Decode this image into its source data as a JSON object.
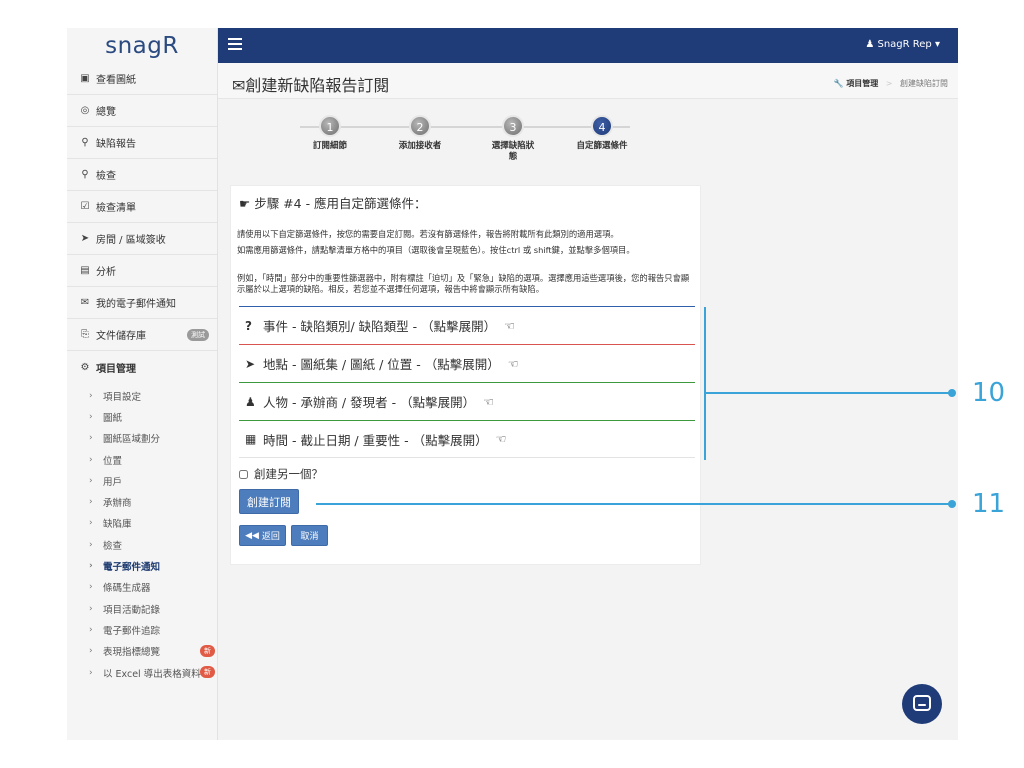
{
  "app": {
    "logo_text": "snagR",
    "user_name": "SnagR Rep",
    "user_icon": "user-icon"
  },
  "sidebar": {
    "items": [
      {
        "icon": "image-icon",
        "glyph": "▣",
        "label": "查看圖紙"
      },
      {
        "icon": "dashboard-icon",
        "glyph": "◎",
        "label": "總覽"
      },
      {
        "icon": "map-marker-icon",
        "glyph": "⚲",
        "label": "缺陷報告"
      },
      {
        "icon": "search-icon",
        "glyph": "⚲",
        "label": "檢查"
      },
      {
        "icon": "checklist-icon",
        "glyph": "☑",
        "label": "檢查清單"
      },
      {
        "icon": "location-arrow-icon",
        "glyph": "➤",
        "label": "房間 / 區域簽收"
      },
      {
        "icon": "bar-chart-icon",
        "glyph": "▤",
        "label": "分析"
      },
      {
        "icon": "envelope-icon",
        "glyph": "✉",
        "label": "我的電子郵件通知"
      },
      {
        "icon": "document-store-icon",
        "glyph": "⎘",
        "label": "文件儲存庫",
        "badge": "測試"
      },
      {
        "icon": "cogs-icon",
        "glyph": "⚙",
        "label": "項目管理"
      }
    ],
    "sub_items": [
      {
        "label": "項目設定"
      },
      {
        "label": "圖紙"
      },
      {
        "label": "圖紙區域劃分"
      },
      {
        "label": "位置"
      },
      {
        "label": "用戶"
      },
      {
        "label": "承辦商"
      },
      {
        "label": "缺陷庫"
      },
      {
        "label": "檢查"
      },
      {
        "label": "電子郵件通知",
        "active": true
      },
      {
        "label": "條碼生成器"
      },
      {
        "label": "項目活動記錄"
      },
      {
        "label": "電子郵件追踪"
      },
      {
        "label": "表現指標總覽",
        "badge": "新"
      },
      {
        "label": "以 Excel 導出表格資料",
        "badge": "新"
      }
    ]
  },
  "header": {
    "title": "創建新缺陷報告訂閱",
    "title_icon": "envelope-icon",
    "breadcrumb": [
      "項目管理",
      "創建缺陷訂閱"
    ],
    "breadcrumb_icon": "wrench-icon"
  },
  "wizard": {
    "current": 4,
    "steps": [
      {
        "number": "1",
        "label": "訂閱細節"
      },
      {
        "number": "2",
        "label": "添加接收者"
      },
      {
        "number": "3",
        "label": "選擇缺陷狀態"
      },
      {
        "number": "4",
        "label": "自定篩選條件"
      }
    ]
  },
  "content": {
    "step_title": "步驟 #4 - 應用自定篩選條件：",
    "step_icon": "hand-pointer-icon",
    "paragraph1": "請使用以下自定篩選條件，按您的需要自定訂閱。若沒有篩選條件，報告將附載所有此類別的適用選項。",
    "paragraph2": "如需應用篩選條件，請點擊清單方格中的項目（選取後會呈現藍色）。按住ctrl 或 shift鍵，並點擊多個項目。",
    "paragraph3": "例如，「時間」部分中的重要性篩選器中，附有標註「迫切」及「緊急」缺陷的選項。選擇應用這些選項後，您的報告只會顯示屬於以上選項的缺陷。相反，若您並不選擇任何選項，報告中將會顯示所有缺陷。",
    "filters": [
      {
        "icon": "question-icon",
        "glyph": "?",
        "label": "事件 - 缺陷類別/ 缺陷類型 - （點擊展開）"
      },
      {
        "icon": "location-arrow-icon",
        "glyph": "➤",
        "label": "地點 - 圖紙集 / 圖紙 / 位置 - （點擊展開）"
      },
      {
        "icon": "users-icon",
        "glyph": "👥",
        "label": "人物 - 承辦商 / 發現者 - （點擊展開）"
      },
      {
        "icon": "calendar-icon",
        "glyph": "▦",
        "label": "時間 - 截止日期 / 重要性 - （點擊展開）"
      }
    ],
    "expand_icon": "hand-point-left-icon",
    "create_another_label": "創建另一個？",
    "create_button": "創建訂閱",
    "back_button": "返回",
    "cancel_button": "取消"
  },
  "annotations": {
    "label_10": "10",
    "label_11": "11",
    "color": "#3aa3d8"
  },
  "colors": {
    "navy": "#1f3b78",
    "button_blue": "#4d7dbd",
    "filter_blue": "#2f5fa9",
    "filter_red": "#d9534f",
    "filter_green": "#3c9a3c",
    "badge_red": "#e05a45"
  }
}
